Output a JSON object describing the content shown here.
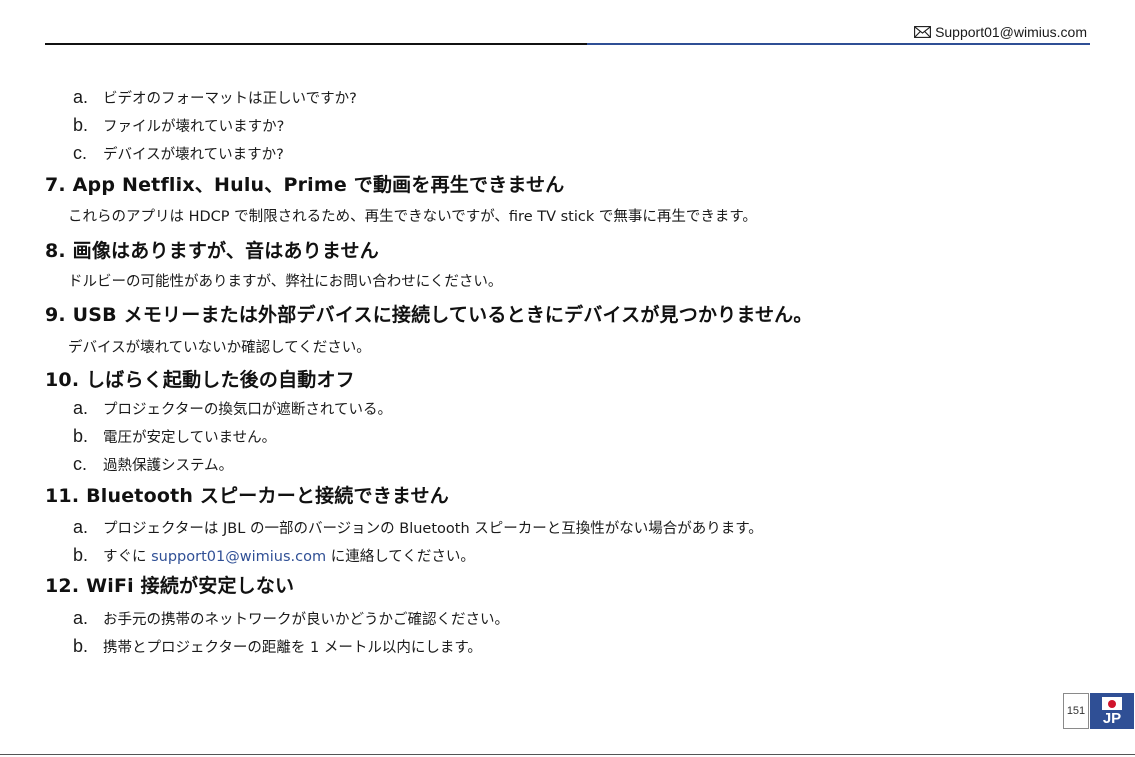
{
  "header": {
    "email": "Support01@wimius.com",
    "icon": "envelope-icon"
  },
  "items": {
    "s6a_letter": "a.",
    "s6a_text": "ビデオのフォーマットは正しいですか?",
    "s6b_letter": "b.",
    "s6b_text": "ファイルが壊れていますか?",
    "s6c_letter": "c.",
    "s6c_text": "デバイスが壊れていますか?",
    "h7": "7.  App Netflix、Hulu、Prime で動画を再生できません",
    "p7": "これらのアプリは HDCP で制限されるため、再生できないですが、fire TV stick で無事に再生できます。",
    "h8": "8. 画像はありますが、音はありません",
    "p8": "ドルビーの可能性がありますが、弊社にお問い合わせにください。",
    "h9": "9. USB メモリーまたは外部デバイスに接続しているときにデバイスが見つかりません。",
    "p9": "デバイスが壊れていないか確認してください。",
    "h10": "10. しばらく起動した後の自動オフ",
    "s10a_letter": "a.",
    "s10a_text": "プロジェクターの換気口が遮断されている。",
    "s10b_letter": "b.",
    "s10b_text": "電圧が安定していません。",
    "s10c_letter": "c.",
    "s10c_text": "過熱保護システム。",
    "h11": "11. Bluetooth スピーカーと接続できません",
    "s11a_letter": "a.",
    "s11a_text": "プロジェクターは JBL の一部のバージョンの Bluetooth スピーカーと互換性がない場合があります。",
    "s11b_letter": "b.",
    "s11b_pre": "すぐに ",
    "s11b_link": "support01@wimius.com",
    "s11b_post": " に連絡してください。",
    "h12": "12. WiFi 接続が安定しない",
    "s12a_letter": "a.",
    "s12a_text": "お手元の携帯のネットワークが良いかどうかご確認ください。",
    "s12b_letter": "b.",
    "s12b_text": "携帯とプロジェクターの距離を 1 メートル以内にします。"
  },
  "footer": {
    "page_number": "151",
    "lang": "JP",
    "flag_icon": "japan-flag-icon"
  },
  "colors": {
    "accent": "#2f4f95",
    "text": "#1a1a1a",
    "flag_red": "#d0142c"
  }
}
